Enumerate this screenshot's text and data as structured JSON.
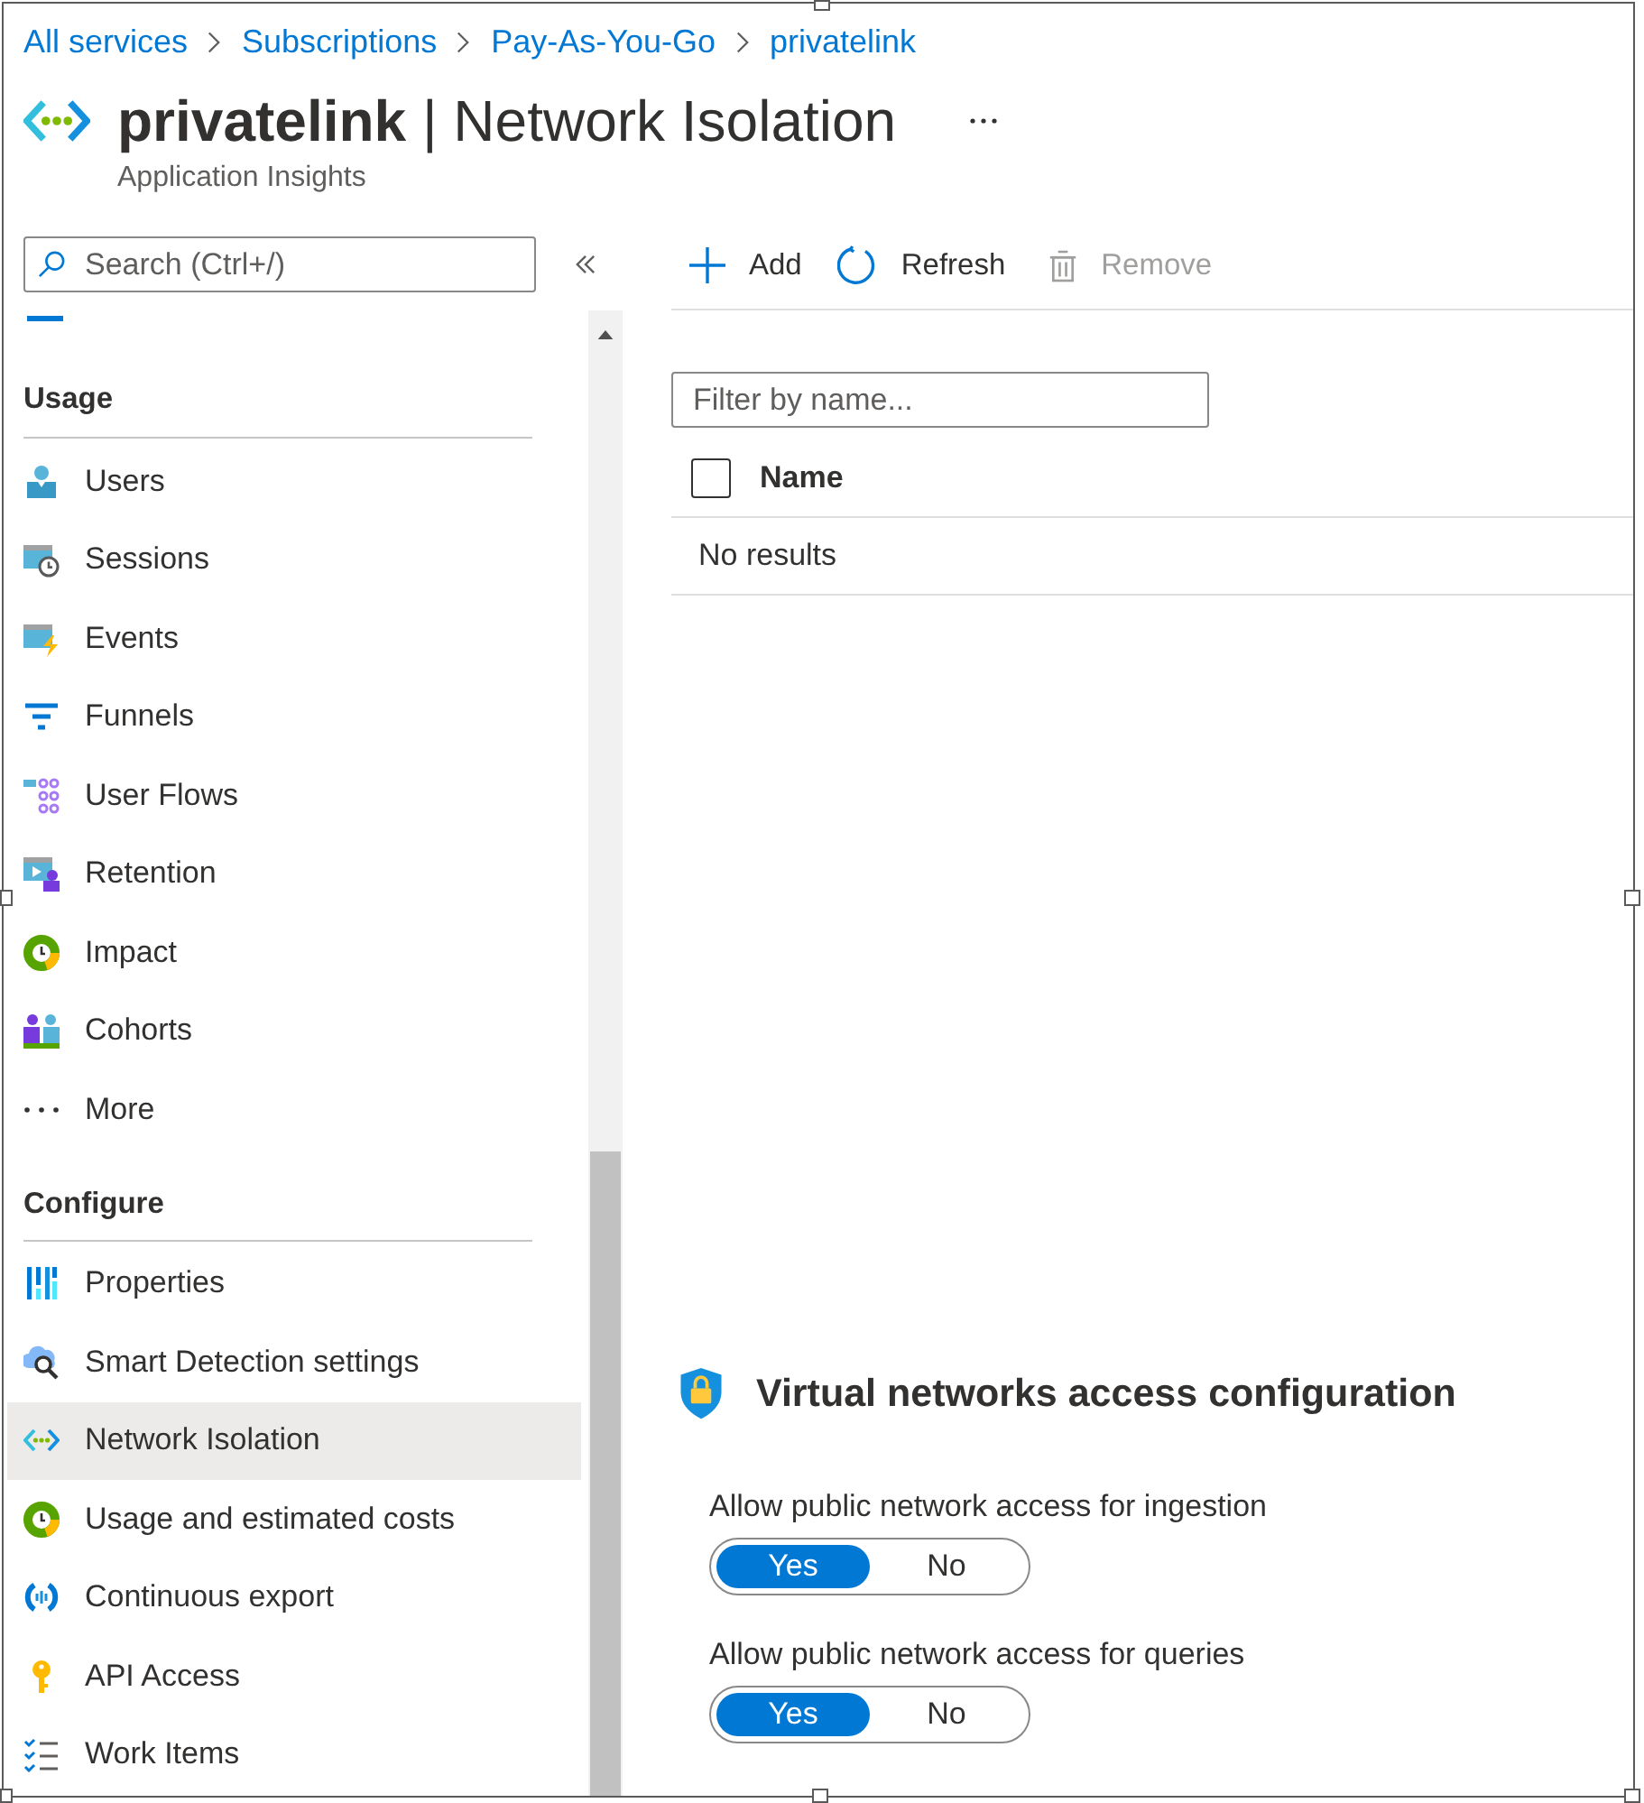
{
  "breadcrumb": [
    {
      "label": "All services"
    },
    {
      "label": "Subscriptions"
    },
    {
      "label": "Pay-As-You-Go"
    },
    {
      "label": "privatelink"
    }
  ],
  "header": {
    "title": "**privatelink** | Network Isolation",
    "subtitle": "Application Insights"
  },
  "sidebar": {
    "search": {
      "placeholder": "Search (Ctrl+/)"
    },
    "sections": [
      {
        "heading": "Usage",
        "items": [
          {
            "label": "Users",
            "selected": false
          },
          {
            "label": "Sessions",
            "selected": false
          },
          {
            "label": "Events",
            "selected": false
          },
          {
            "label": "Funnels",
            "selected": false
          },
          {
            "label": "User Flows",
            "selected": false
          },
          {
            "label": "Retention",
            "selected": false
          },
          {
            "label": "Impact",
            "selected": false
          },
          {
            "label": "Cohorts",
            "selected": false
          },
          {
            "label": "More",
            "selected": false
          }
        ]
      },
      {
        "heading": "Configure",
        "items": [
          {
            "label": "Properties",
            "selected": false
          },
          {
            "label": "Smart Detection settings",
            "selected": false
          },
          {
            "label": "Network Isolation",
            "selected": true
          },
          {
            "label": "Usage and estimated costs",
            "selected": false
          },
          {
            "label": "Continuous export",
            "selected": false
          },
          {
            "label": "API Access",
            "selected": false
          },
          {
            "label": "Work Items",
            "selected": false
          }
        ]
      }
    ]
  },
  "toolbar": [
    {
      "label": "Add",
      "disabled": false
    },
    {
      "label": "Refresh",
      "disabled": false
    },
    {
      "label": "Remove",
      "disabled": true
    }
  ],
  "filter": {
    "placeholder": "Filter by name..."
  },
  "table": {
    "select_all": {
      "checked": false
    },
    "columns": [
      {
        "label": "Name"
      }
    ],
    "empty_text": "No results"
  },
  "access_configuration": {
    "title": "Virtual networks access configuration",
    "settings": [
      {
        "label": "Allow public network access for ingestion",
        "options": [
          {
            "label": "Yes",
            "selected": true
          },
          {
            "label": "No",
            "selected": false
          }
        ]
      },
      {
        "label": "Allow public network access for queries",
        "options": [
          {
            "label": "Yes",
            "selected": true
          },
          {
            "label": "No",
            "selected": false
          }
        ]
      }
    ]
  }
}
